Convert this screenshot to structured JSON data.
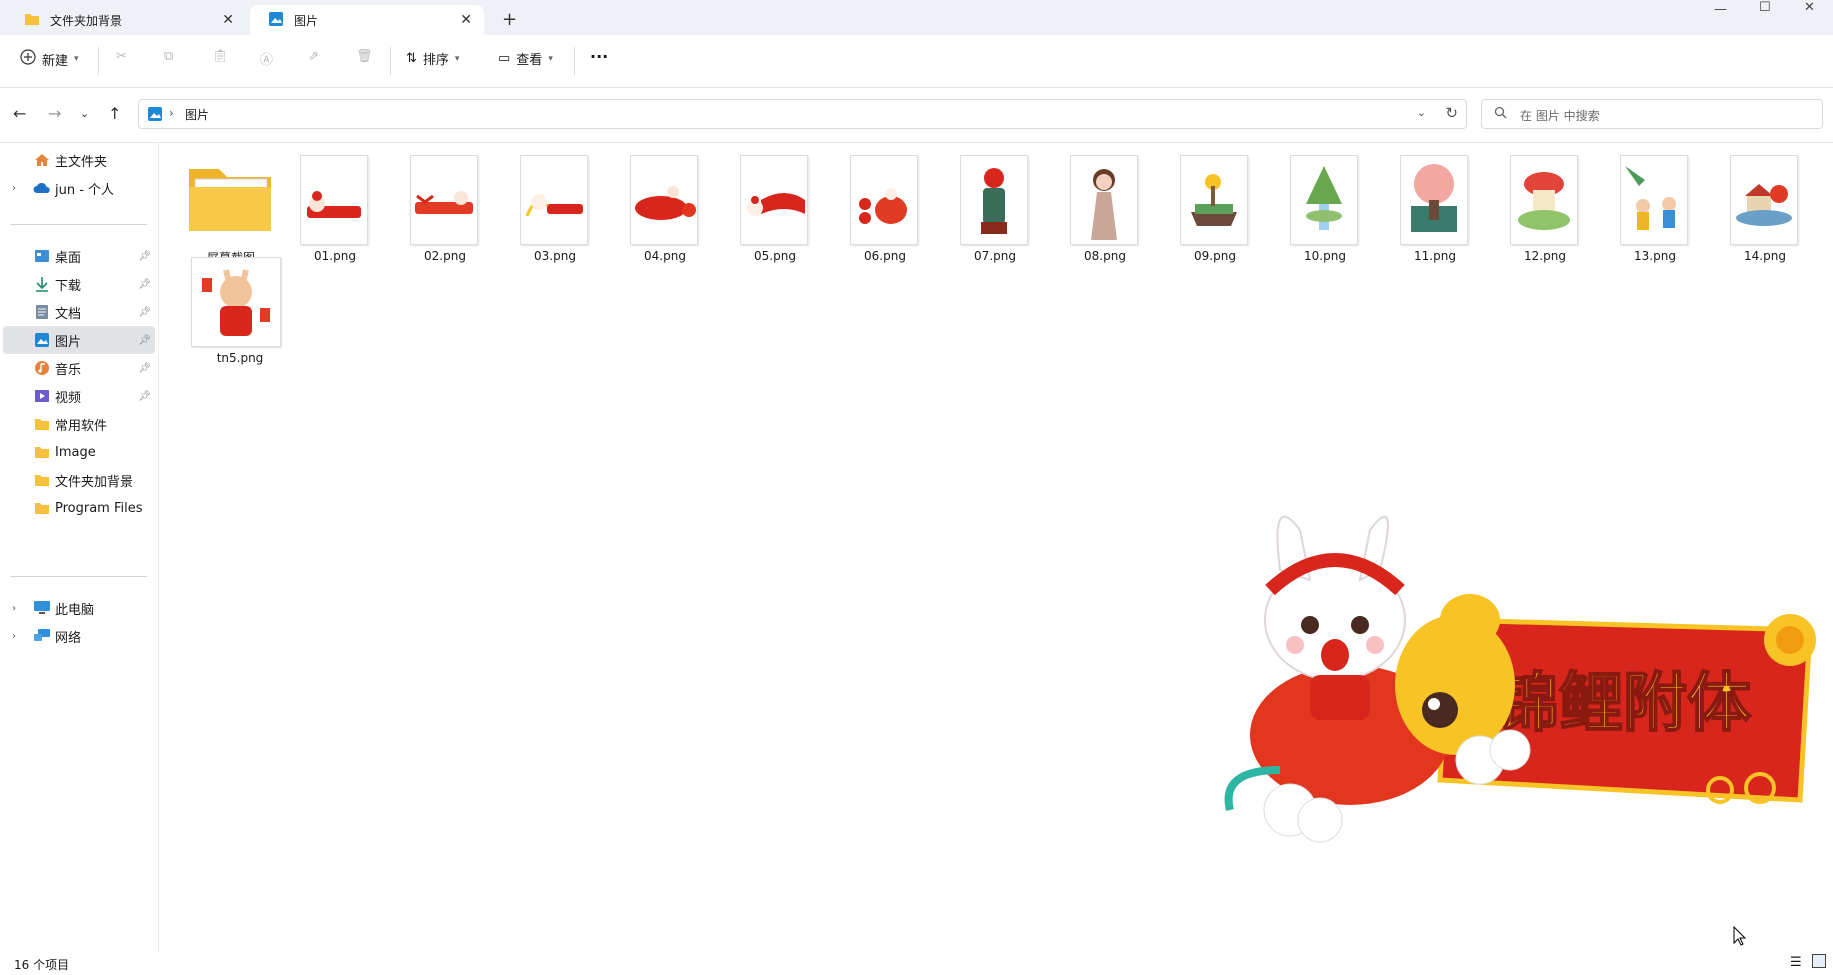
{
  "tabs": [
    {
      "label": "文件夹加背景",
      "icon": "folder-icon"
    },
    {
      "label": "图片",
      "icon": "pictures-icon"
    }
  ],
  "toolbar": {
    "new_label": "新建",
    "sort_label": "排序",
    "view_label": "查看",
    "more_label": "···"
  },
  "address": {
    "current": "图片"
  },
  "search": {
    "placeholder": "在 图片 中搜索"
  },
  "sidebar": {
    "items": [
      {
        "label": "主文件夹",
        "icon": "home-icon"
      },
      {
        "label": "jun - 个人",
        "icon": "cloud-icon"
      },
      {
        "label": "桌面",
        "icon": "desktop-icon"
      },
      {
        "label": "下载",
        "icon": "download-icon"
      },
      {
        "label": "文档",
        "icon": "document-icon"
      },
      {
        "label": "图片",
        "icon": "pictures-icon"
      },
      {
        "label": "音乐",
        "icon": "music-icon"
      },
      {
        "label": "视频",
        "icon": "video-icon"
      },
      {
        "label": "常用软件",
        "icon": "folder-icon"
      },
      {
        "label": "Image",
        "icon": "folder-icon"
      },
      {
        "label": "文件夹加背景",
        "icon": "folder-icon"
      },
      {
        "label": "Program Files",
        "icon": "folder-icon"
      },
      {
        "label": "此电脑",
        "icon": "computer-icon"
      },
      {
        "label": "网络",
        "icon": "network-icon"
      }
    ]
  },
  "files": [
    {
      "name": "屏幕截图",
      "type": "folder"
    },
    {
      "name": "01.png",
      "type": "image"
    },
    {
      "name": "02.png",
      "type": "image"
    },
    {
      "name": "03.png",
      "type": "image"
    },
    {
      "name": "04.png",
      "type": "image"
    },
    {
      "name": "05.png",
      "type": "image"
    },
    {
      "name": "06.png",
      "type": "image"
    },
    {
      "name": "07.png",
      "type": "image"
    },
    {
      "name": "08.png",
      "type": "image"
    },
    {
      "name": "09.png",
      "type": "image"
    },
    {
      "name": "10.png",
      "type": "image"
    },
    {
      "name": "11.png",
      "type": "image"
    },
    {
      "name": "12.png",
      "type": "image"
    },
    {
      "name": "13.png",
      "type": "image"
    },
    {
      "name": "14.png",
      "type": "image"
    },
    {
      "name": "tn5.png",
      "type": "image"
    }
  ],
  "status": {
    "count": "16 个项目"
  },
  "preview": {
    "banner_text": "锦鲤附体"
  },
  "colors": {
    "accent": "#0067c0",
    "folder": "#f5c13b",
    "red": "#d9261c",
    "gold": "#f7c325"
  }
}
